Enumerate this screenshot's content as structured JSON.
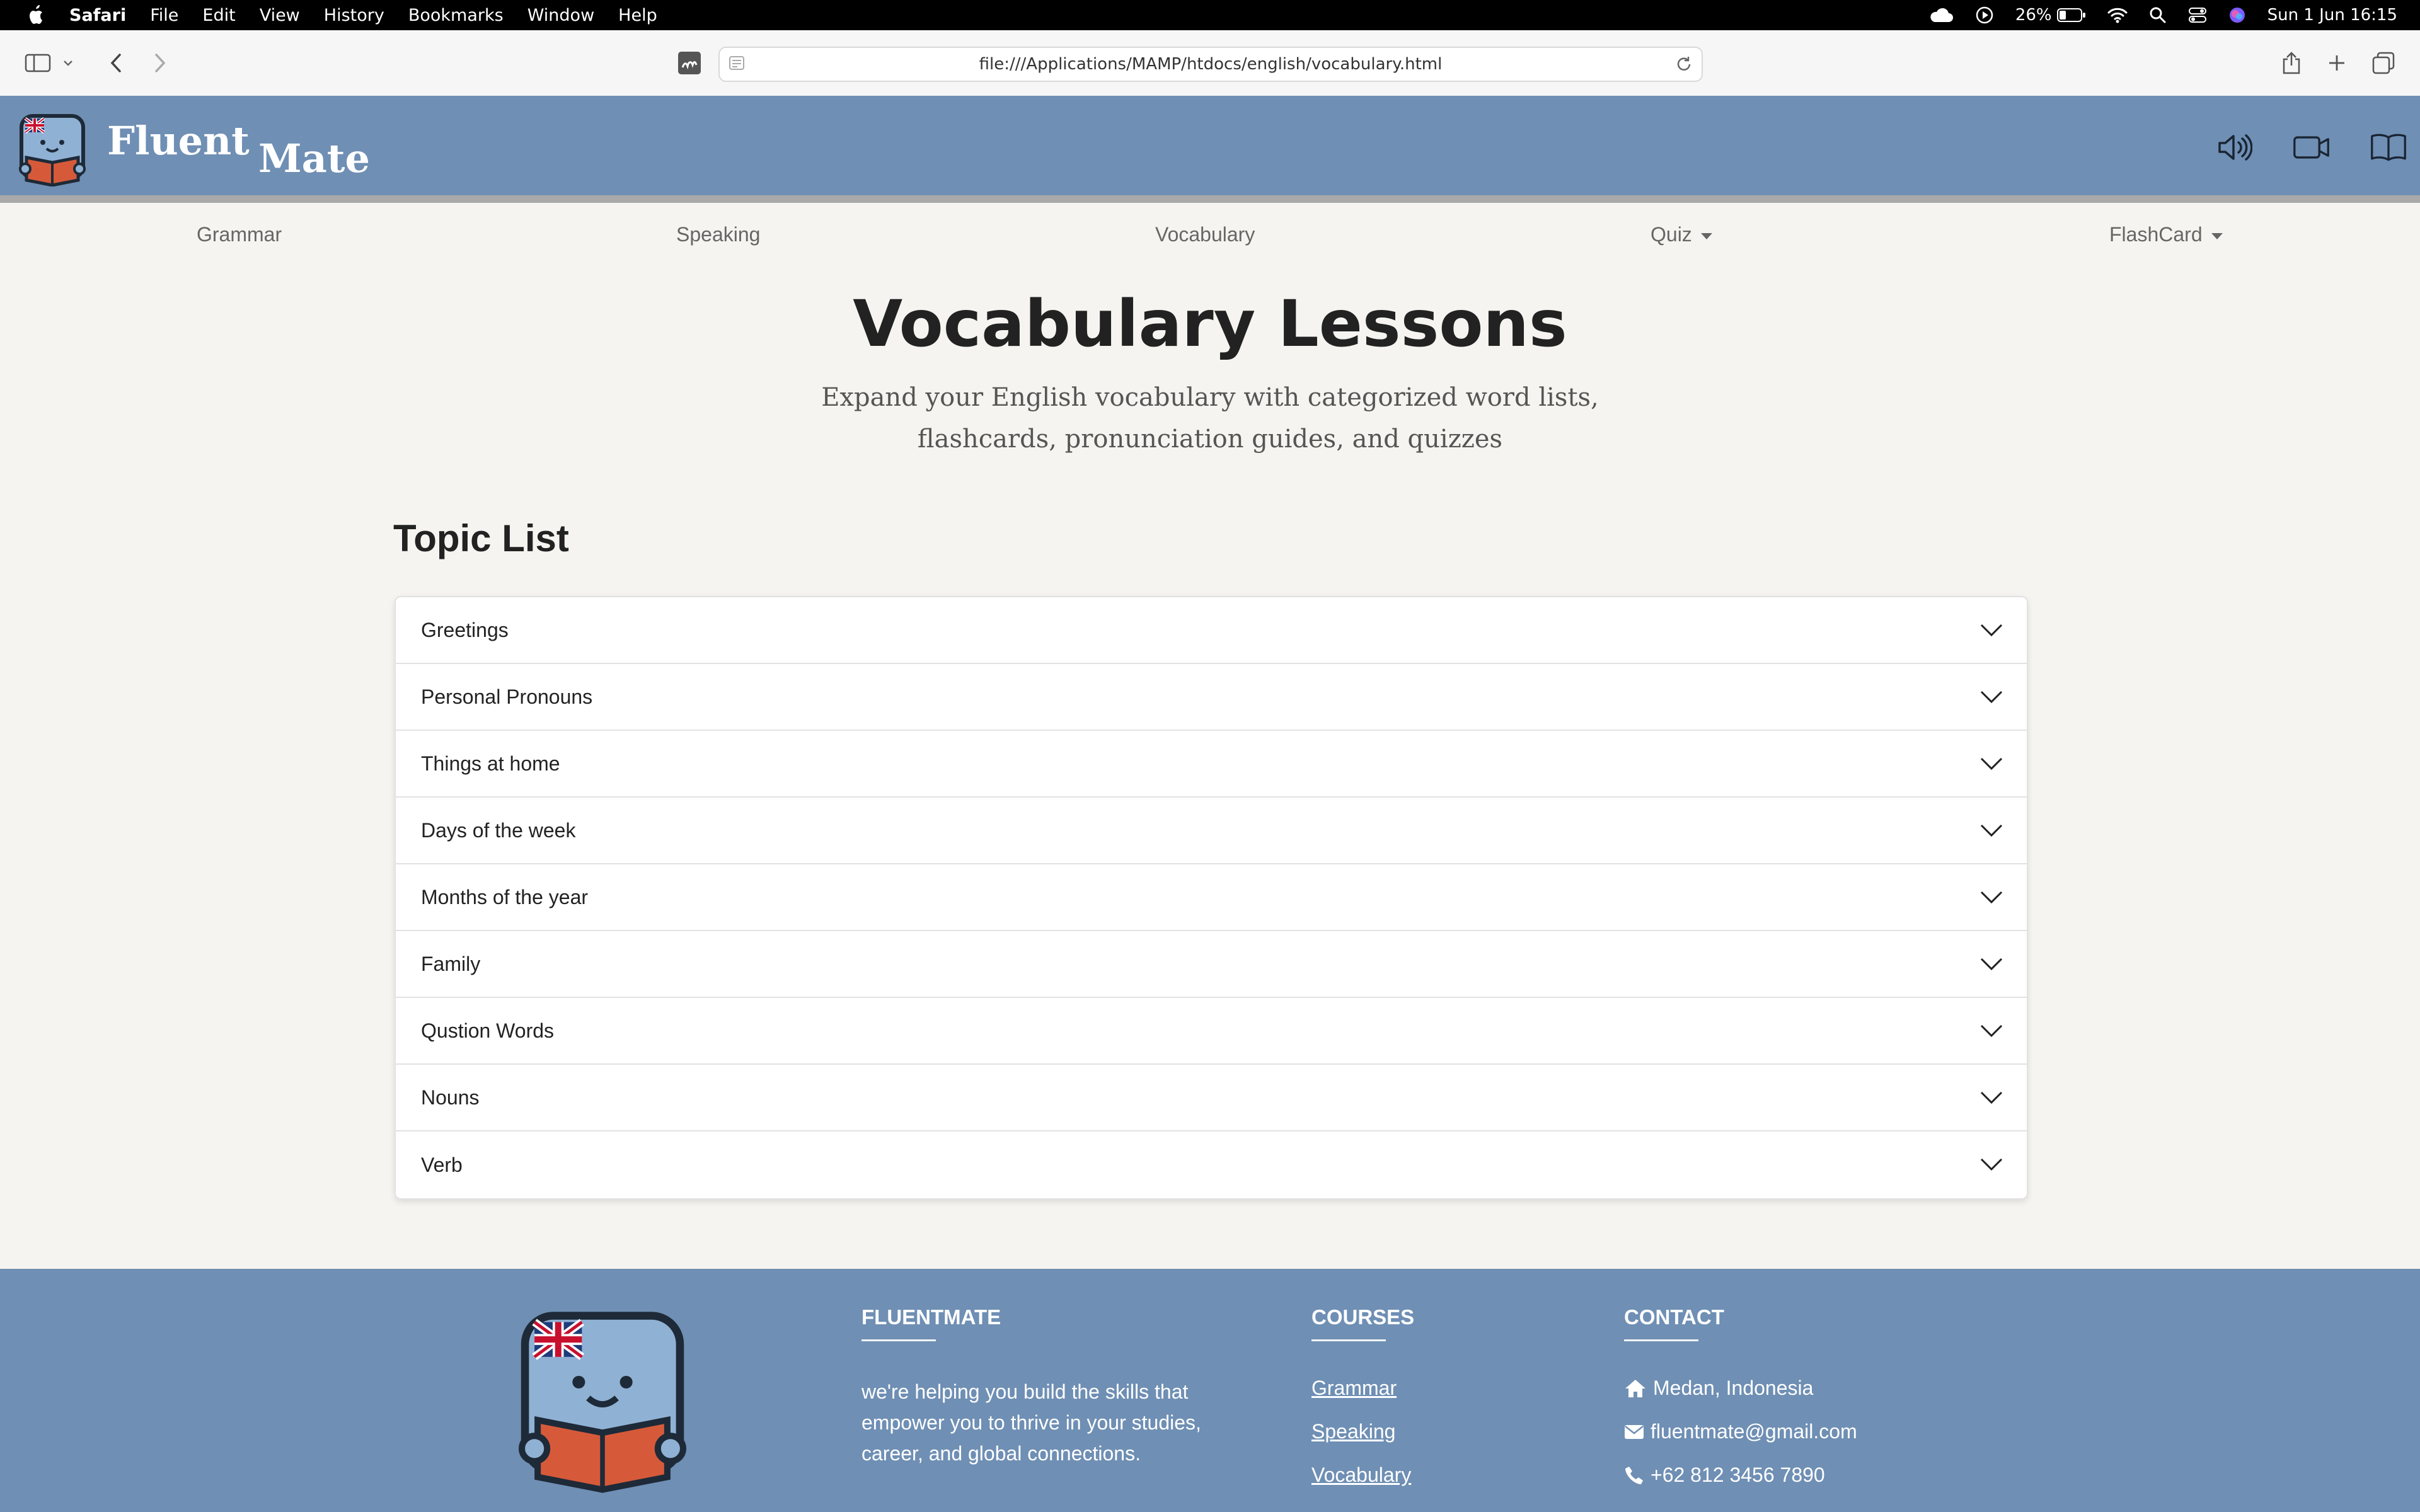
{
  "menubar": {
    "app": "Safari",
    "items": [
      "File",
      "Edit",
      "View",
      "History",
      "Bookmarks",
      "Window",
      "Help"
    ],
    "battery": "26%",
    "datetime": "Sun 1 Jun  16:15"
  },
  "browser": {
    "url": "file:///Applications/MAMP/htdocs/english/vocabulary.html"
  },
  "header": {
    "brand_part1": "Fluent",
    "brand_part2": "Mate"
  },
  "nav": {
    "items": [
      {
        "label": "Grammar"
      },
      {
        "label": "Speaking"
      },
      {
        "label": "Vocabulary"
      },
      {
        "label": "Quiz",
        "dropdown": true
      },
      {
        "label": "FlashCard",
        "dropdown": true
      }
    ]
  },
  "hero": {
    "title": "Vocabulary Lessons",
    "subtitle": "Expand your English vocabulary with categorized word lists, flashcards, pronunciation guides, and quizzes"
  },
  "topics": {
    "title": "Topic List",
    "items": [
      "Greetings",
      "Personal Pronouns",
      "Things at home",
      "Days of the week",
      "Months of the year",
      "Family",
      "Qustion Words",
      "Nouns",
      "Verb"
    ]
  },
  "footer": {
    "about_title": "FLUENTMATE",
    "about_text": "we're helping you build the skills that empower you to thrive in your studies, career, and global connections.",
    "courses_title": "COURSES",
    "courses": [
      "Grammar",
      "Speaking",
      "Vocabulary"
    ],
    "contact_title": "CONTACT",
    "address": "Medan, Indonesia",
    "email": "fluentmate@gmail.com",
    "phone": "+62 812 3456 7890"
  },
  "colors": {
    "header_bg": "#6f8fb4",
    "page_bg": "#f5f4f0",
    "footer_bg": "#6f8fb4"
  }
}
